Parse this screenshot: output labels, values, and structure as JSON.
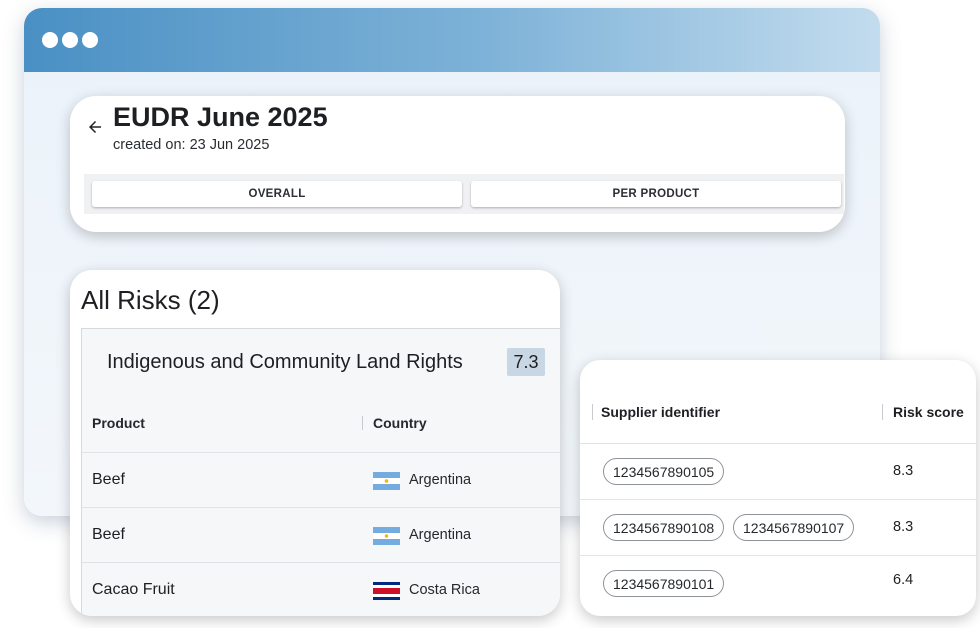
{
  "header": {
    "title": "EUDR June 2025",
    "created": "created on: 23 Jun 2025",
    "tabs": [
      {
        "label": "OVERALL"
      },
      {
        "label": "PER PRODUCT"
      }
    ]
  },
  "risks": {
    "title": "All Risks (2)",
    "risk_name": "Indigenous and Community Land Rights",
    "risk_score": "7.3",
    "columns": {
      "product": "Product",
      "country": "Country"
    },
    "rows": [
      {
        "product": "Beef",
        "country": "Argentina",
        "flag": "argentina-flag"
      },
      {
        "product": "Beef",
        "country": "Argentina",
        "flag": "argentina-flag"
      },
      {
        "product": "Cacao Fruit",
        "country": "Costa Rica",
        "flag": "costa-rica-flag"
      }
    ]
  },
  "suppliers": {
    "columns": {
      "id": "Supplier identifier",
      "score": "Risk score"
    },
    "rows": [
      {
        "ids": [
          "1234567890105"
        ],
        "score": "8.3"
      },
      {
        "ids": [
          "1234567890108",
          "1234567890107"
        ],
        "score": "8.3"
      },
      {
        "ids": [
          "1234567890101"
        ],
        "score": "6.4"
      }
    ]
  },
  "colors": {
    "window_bar_start": "#4a90c4",
    "window_bar_end": "#c3dcee",
    "score_badge": "#c9d6e3"
  }
}
